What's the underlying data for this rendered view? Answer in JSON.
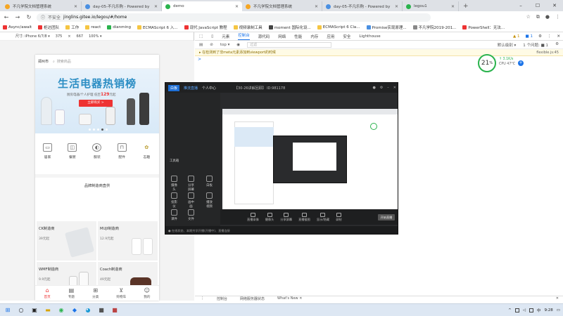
{
  "browser": {
    "tabs": [
      {
        "title": "不凡学院文档管理系统",
        "color": "#f5a623",
        "active": false
      },
      {
        "title": "day-05-不凡乐购 - Powered by",
        "color": "#4a90e2",
        "active": false
      },
      {
        "title": "demo",
        "color": "#2ab34d",
        "active": true
      },
      {
        "title": "不凡学院文档管理系统",
        "color": "#f5a623",
        "active": false
      },
      {
        "title": "day-05-不凡乐购 - Powered by",
        "color": "#4a90e2",
        "active": false
      },
      {
        "title": "legou1",
        "color": "#2ab34d",
        "active": false
      }
    ],
    "window_controls": [
      "–",
      "☐",
      "✕"
    ],
    "address": {
      "security": "不安全",
      "url": "jinglins.gitee.io/legou/#/home"
    },
    "bookmarks": [
      {
        "label": "Async/await",
        "color": "#e33"
      },
      {
        "label": "柜达团队",
        "color": "#e33"
      },
      {
        "label": "工作",
        "color": "#f5c542"
      },
      {
        "label": "react",
        "color": "#f5c542"
      },
      {
        "label": "dianming",
        "color": "#2ab34d"
      },
      {
        "label": "ECMAScript 6 入...",
        "color": "#f5c542"
      },
      {
        "label": "现代 JavaScript 教程",
        "color": "#e33"
      },
      {
        "label": "视频录制工具",
        "color": "#f5c542"
      },
      {
        "label": "moment 国际化设...",
        "color": "#444"
      },
      {
        "label": "ECMAScript 6 Cla...",
        "color": "#f5c542"
      },
      {
        "label": "Promise实现原理...",
        "color": "#4a90e2"
      },
      {
        "label": "不凡学院2019-201...",
        "color": "#888"
      },
      {
        "label": "PowerShell：无法...",
        "color": "#e33"
      }
    ]
  },
  "device_toolbar": {
    "device": "尺寸: iPhone 6/7/8 ▾",
    "width": "375",
    "height": "667",
    "zoom": "100% ▾"
  },
  "phone": {
    "city": "郑州市",
    "search_placeholder": "搜索商品",
    "banner": {
      "title": "生活电器热销榜",
      "subtitle": "厨房电器/个人护理 低至",
      "price": "129",
      "price_suffix": "元起",
      "button": "立即购买 >"
    },
    "categories": [
      {
        "label": "居家",
        "icon": "sofa-icon"
      },
      {
        "label": "餐厨",
        "icon": "pot-icon"
      },
      {
        "label": "服装",
        "icon": "shirt-icon"
      },
      {
        "label": "配件",
        "icon": "bag-icon"
      },
      {
        "label": "志趣",
        "icon": "star-icon"
      }
    ],
    "brand_title": "品牌制造商直供",
    "brands": [
      {
        "name": "CK制造商",
        "price": "39元起"
      },
      {
        "name": "MUJI制造商",
        "price": "12.9元起"
      },
      {
        "name": "WMF制造商",
        "price": "9.9元起"
      },
      {
        "name": "Coach制造商",
        "price": "49元起"
      }
    ],
    "tabbar": [
      {
        "label": "首页",
        "icon": "home-icon",
        "active": true
      },
      {
        "label": "专题",
        "icon": "topic-icon",
        "active": false
      },
      {
        "label": "分类",
        "icon": "category-icon",
        "active": false
      },
      {
        "label": "购物车",
        "icon": "cart-icon",
        "active": false
      },
      {
        "label": "我的",
        "icon": "user-icon",
        "active": false
      }
    ]
  },
  "devtools": {
    "tabs": [
      "元素",
      "控制台",
      "源代码",
      "网络",
      "性能",
      "内存",
      "应用",
      "安全",
      "Lighthouse"
    ],
    "active_tab": "控制台",
    "warning_count": "▲ 1",
    "info_count": "■ 1",
    "context": "top ▾",
    "filter_placeholder": "过滤",
    "levels": "默认级别 ▾",
    "issues": "1 个问题: ■ 1",
    "warning_text": "▸ 在检测到了非meta元素添加到viewport的时候",
    "warning_source": "flexible.js:45",
    "prompt": ">",
    "perf_percent": "21",
    "perf_unit": "%",
    "perf_rate": "↑ 3.1K/s",
    "perf_cpu": "CPU 47°C",
    "drawer_tabs": [
      "控制台",
      "网络服务器状态",
      "What's New ✕"
    ]
  },
  "recorder": {
    "app_name": "白板",
    "top_items": [
      "推流直播",
      "个人中心"
    ],
    "room": "【30-26讲解回顾】 ID:981178",
    "left_labels": [
      "工具箱",
      "摄像头",
      "分享屏幕",
      "白板",
      "投影仪",
      "画中画",
      "播放视频",
      "课件",
      "文件"
    ],
    "bottom_items": [
      "直播录像",
      "摄像头",
      "分享屏幕",
      "直播截图",
      "显示/隐藏",
      "录制"
    ],
    "live_button": "开始直播",
    "status": "● 在线状态、本期共学开播(开播中)、直播连接"
  },
  "taskbar": {
    "time": "9:28",
    "apps": [
      "windows-start-icon",
      "search-icon",
      "task-view-icon",
      "folder-icon",
      "chrome-icon",
      "vscode-icon",
      "edge-icon",
      "app-icon",
      "app-icon"
    ]
  }
}
